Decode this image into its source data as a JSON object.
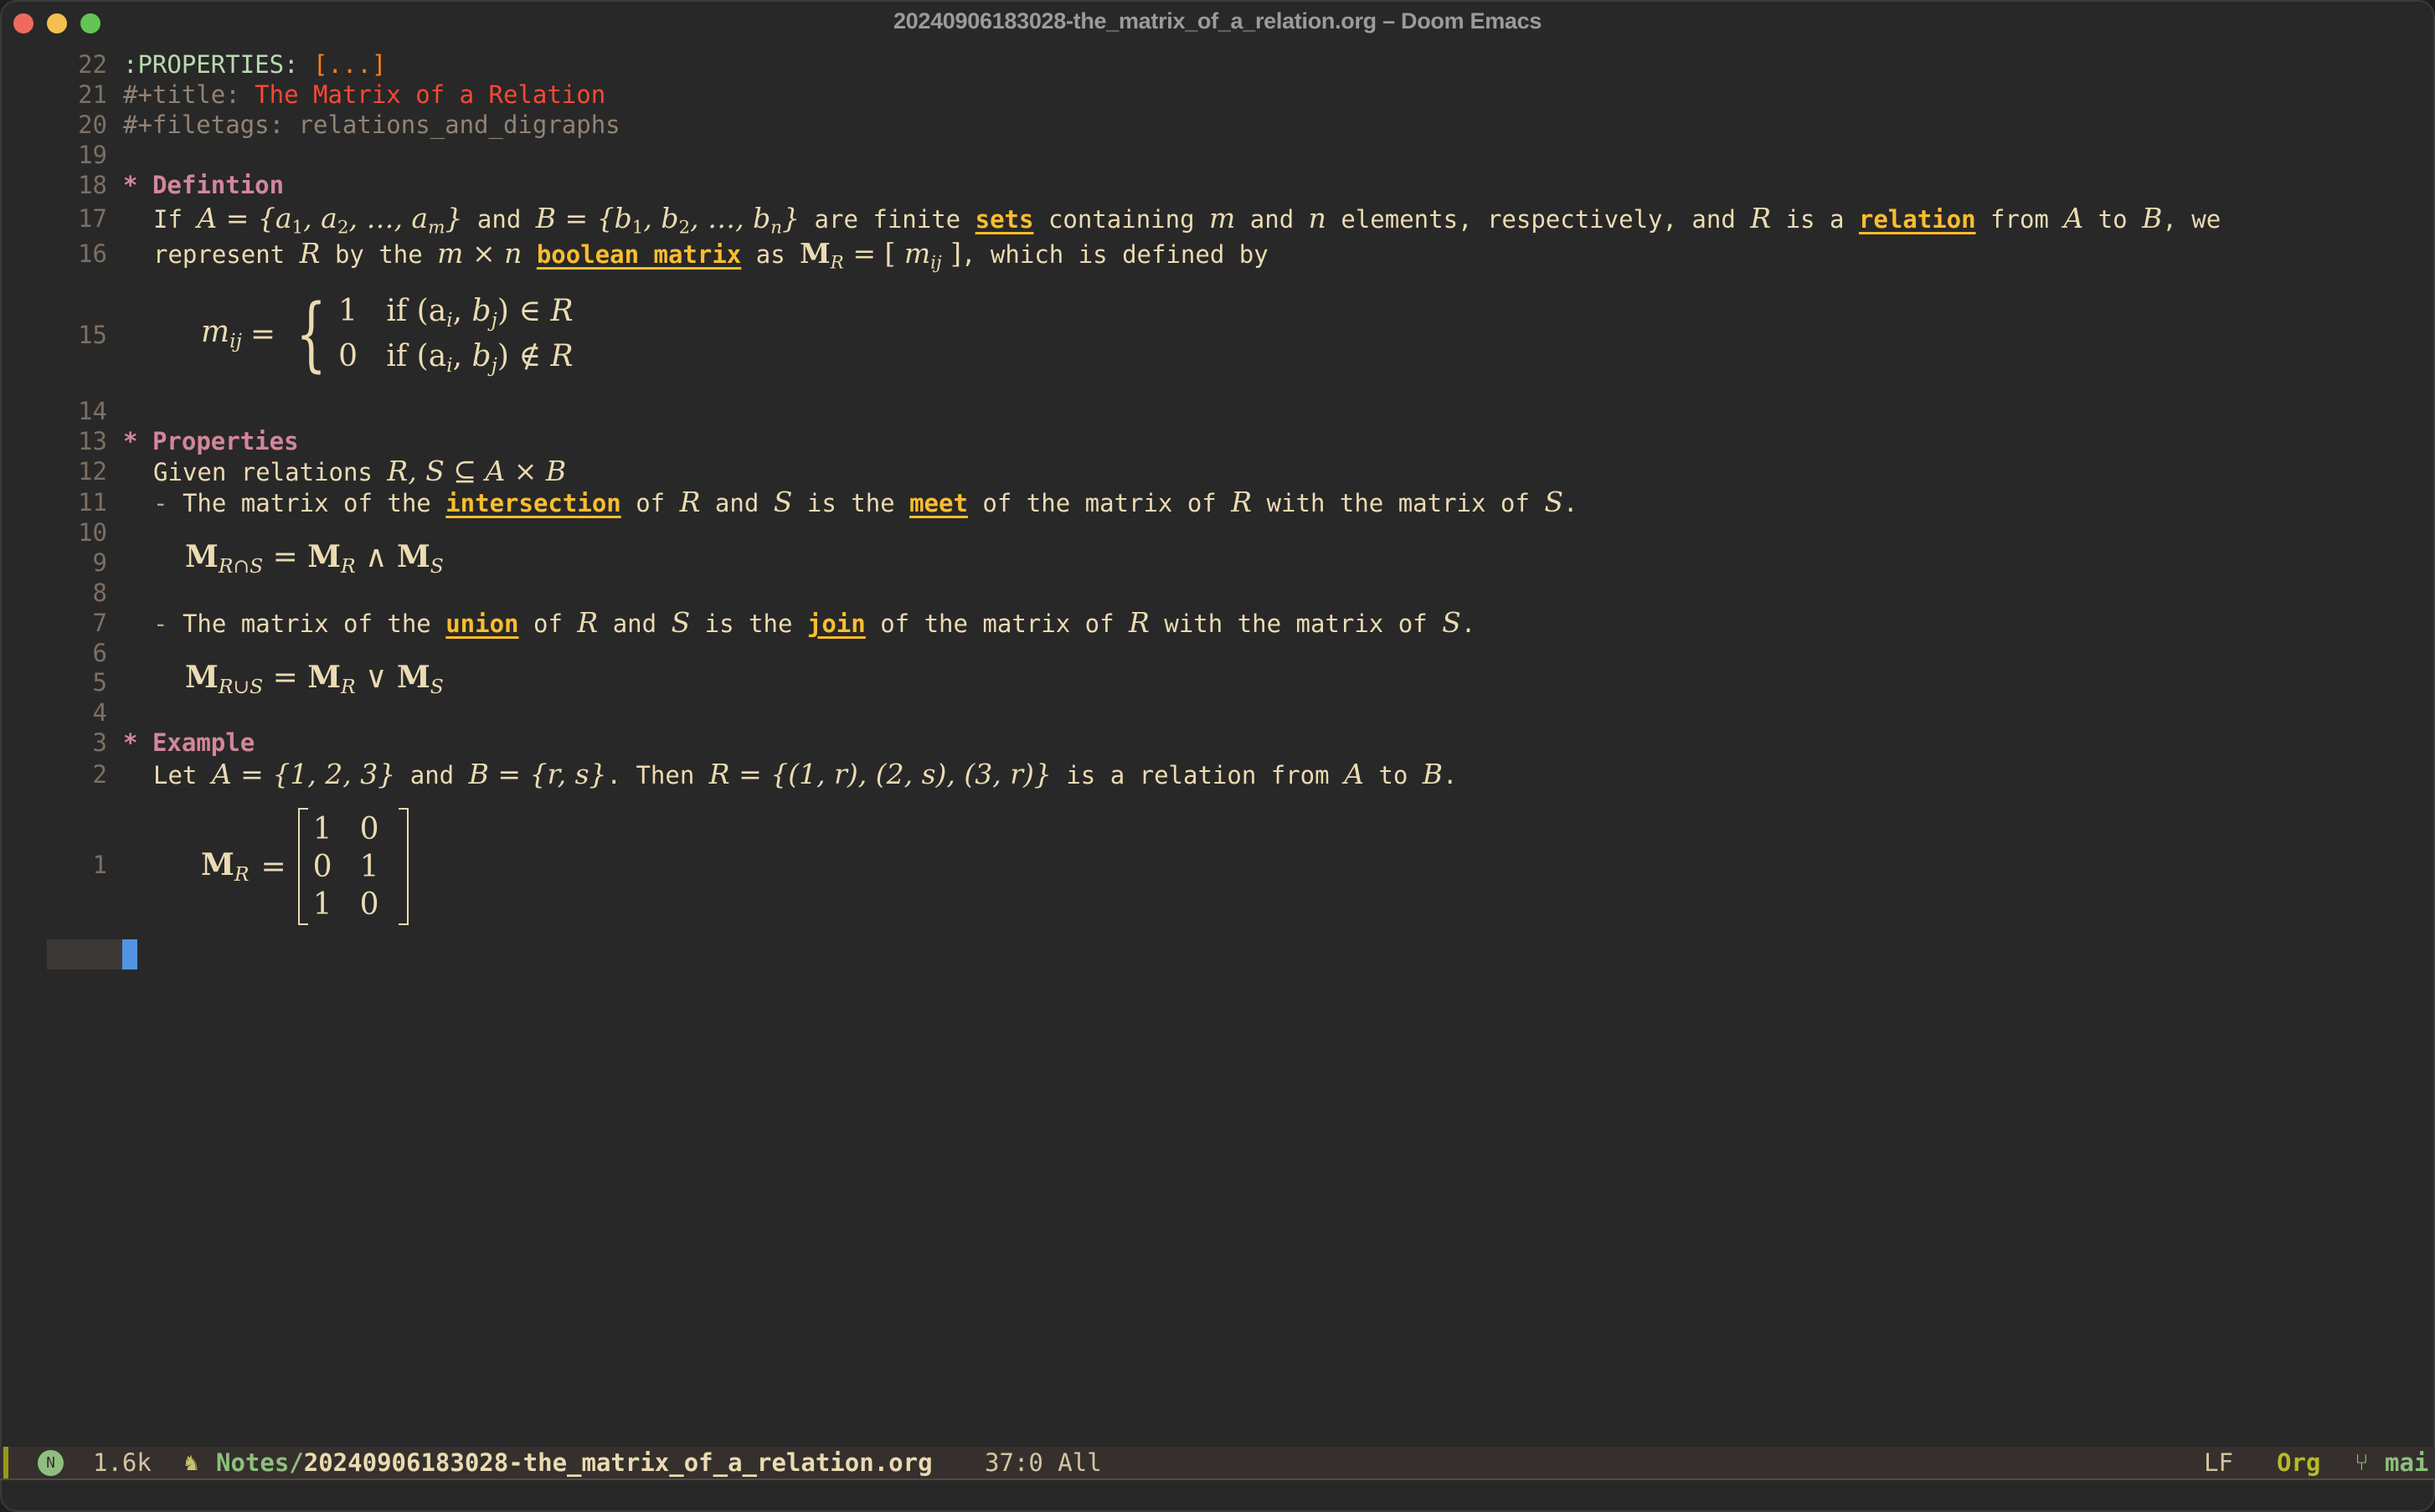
{
  "window": {
    "title": "20240906183028-the_matrix_of_a_relation.org – Doom Emacs"
  },
  "editor": {
    "lines": {
      "l22": {
        "num": "22",
        "key": ":PROPERTIES:",
        "fold": "[...]"
      },
      "l21": {
        "num": "21",
        "key": "#+title:",
        "value": "The Matrix of a Relation"
      },
      "l20": {
        "num": "20",
        "key": "#+filetags:",
        "value": "relations_and_digraphs"
      },
      "l19": {
        "num": "19"
      },
      "l18": {
        "num": "18",
        "star": "*",
        "heading": "Defintion"
      },
      "l17": {
        "num": "17",
        "t1": "If",
        "m1": "A = {a",
        "t2": "and",
        "m2": "B = {b",
        "t3": "are finite",
        "link1": "sets",
        "t4": "containing",
        "m3": "m",
        "t5": "and",
        "m4": "n",
        "t6": "elements, respectively, and",
        "m5": "R",
        "t7": "is a",
        "link2": "relation",
        "t8": "from",
        "m6": "A",
        "t9": "to",
        "m7": "B",
        "t10": ", we"
      },
      "l16": {
        "num": "16",
        "t1": "represent",
        "m1": "R",
        "t2": "by the",
        "m2": "m × n",
        "link1": "boolean matrix",
        "t3": "as",
        "t4": ", which is defined by"
      },
      "l15": {
        "num": "15",
        "lhs": "m",
        "case1_val": "1",
        "case1_cond": "if (a",
        "case2_val": "0",
        "case2_cond": "if (a"
      },
      "l14": {
        "num": "14"
      },
      "l13": {
        "num": "13",
        "star": "*",
        "heading": "Properties"
      },
      "l12": {
        "num": "12",
        "t1": "Given relations",
        "m1": "R, S ⊆ A × B"
      },
      "l11": {
        "num": "11",
        "bullet": "-",
        "t1": "The matrix of the",
        "link1": "intersection",
        "t2": "of",
        "m1": "R",
        "t3": "and",
        "m2": "S",
        "t4": "is the",
        "link2": "meet",
        "t5": "of the matrix of",
        "m3": "R",
        "t6": "with the matrix of",
        "m4": "S",
        "t7": "."
      },
      "l10": {
        "num": "10"
      },
      "l9": {
        "num": "9",
        "op": "∧",
        "sub_op": "∩"
      },
      "l8": {
        "num": "8"
      },
      "l7": {
        "num": "7",
        "bullet": "-",
        "t1": "The matrix of the",
        "link1": "union",
        "t2": "of",
        "m1": "R",
        "t3": "and",
        "m2": "S",
        "t4": "is the",
        "link2": "join",
        "t5": "of the matrix of",
        "m3": "R",
        "t6": "with the matrix of",
        "m4": "S",
        "t7": "."
      },
      "l6": {
        "num": "6"
      },
      "l5": {
        "num": "5",
        "op": "∨",
        "sub_op": "∪"
      },
      "l4": {
        "num": "4"
      },
      "l3": {
        "num": "3",
        "star": "*",
        "heading": "Example"
      },
      "l2": {
        "num": "2",
        "t1": "Let",
        "m1": "A = {1, 2, 3}",
        "t2": "and",
        "m2": "B = {r, s}",
        "t3": ". Then",
        "m3": "R = {(1, r), (2, s), (3, r)}",
        "t4": "is a relation from",
        "m4": "A",
        "t5": "to",
        "m5": "B",
        "t6": "."
      },
      "l1": {
        "num": "1",
        "matrix": [
          [
            "1",
            "0"
          ],
          [
            "0",
            "1"
          ],
          [
            "1",
            "0"
          ]
        ]
      }
    }
  },
  "statusbar": {
    "state_badge": "N",
    "size": "1.6k",
    "mode_icon": "unicorn-icon",
    "dir": "Notes/",
    "file": "20240906183028-the_matrix_of_a_relation.org",
    "position": "37:0 All",
    "eol": "LF",
    "major_mode": "Org",
    "branch_icon": "git-branch-icon",
    "branch": "mai"
  },
  "colors": {
    "background": "#282828",
    "link": "#fabd2f",
    "heading": "#d3869b",
    "title": "#fb4934",
    "cursor": "#5294e2"
  }
}
